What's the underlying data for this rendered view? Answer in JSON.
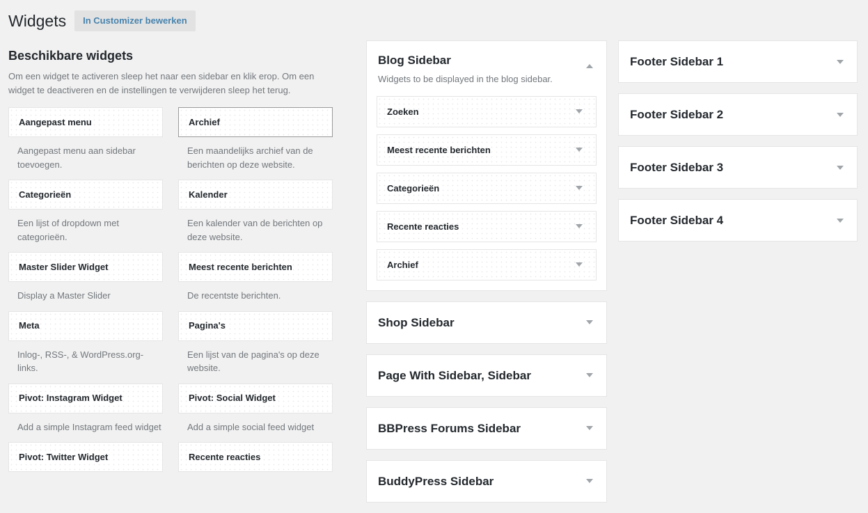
{
  "header": {
    "title": "Widgets",
    "customizer_link": "In Customizer bewerken"
  },
  "available": {
    "heading": "Beschikbare widgets",
    "description": "Om een widget te activeren sleep het naar een sidebar en klik erop. Om een widget te deactiveren en de instellingen te verwijderen sleep het terug.",
    "widgets": [
      {
        "title": "Aangepast menu",
        "description": "Aangepast menu aan sidebar toevoegen.",
        "active": false
      },
      {
        "title": "Archief",
        "description": "Een maandelijks archief van de berichten op deze website.",
        "active": true
      },
      {
        "title": "Categorieën",
        "description": "Een lijst of dropdown met categorieën.",
        "active": false
      },
      {
        "title": "Kalender",
        "description": "Een kalender van de berichten op deze website.",
        "active": false
      },
      {
        "title": "Master Slider Widget",
        "description": "Display a Master Slider",
        "active": false
      },
      {
        "title": "Meest recente berichten",
        "description": "De recentste berichten.",
        "active": false
      },
      {
        "title": "Meta",
        "description": "Inlog-, RSS-, & WordPress.org-links.",
        "active": false
      },
      {
        "title": "Pagina's",
        "description": "Een lijst van de pagina's op deze website.",
        "active": false
      },
      {
        "title": "Pivot: Instagram Widget",
        "description": "Add a simple Instagram feed widget",
        "active": false
      },
      {
        "title": "Pivot: Social Widget",
        "description": "Add a simple social feed widget",
        "active": false
      },
      {
        "title": "Pivot: Twitter Widget",
        "description": "",
        "active": false
      },
      {
        "title": "Recente reacties",
        "description": "",
        "active": false
      }
    ]
  },
  "center_sidebars": [
    {
      "name": "Blog Sidebar",
      "description": "Widgets to be displayed in the blog sidebar.",
      "expanded": true,
      "toggle_icon": "chevron-up-icon",
      "widgets": [
        {
          "title": "Zoeken",
          "toggle_icon": "chevron-down-icon"
        },
        {
          "title": "Meest recente berichten",
          "toggle_icon": "chevron-down-icon"
        },
        {
          "title": "Categorieën",
          "toggle_icon": "chevron-down-icon"
        },
        {
          "title": "Recente reacties",
          "toggle_icon": "chevron-down-icon"
        },
        {
          "title": "Archief",
          "toggle_icon": "chevron-down-icon"
        }
      ]
    },
    {
      "name": "Shop Sidebar",
      "description": "",
      "expanded": false,
      "toggle_icon": "chevron-down-icon",
      "widgets": []
    },
    {
      "name": "Page With Sidebar, Sidebar",
      "description": "",
      "expanded": false,
      "toggle_icon": "chevron-down-icon",
      "widgets": []
    },
    {
      "name": "BBPress Forums Sidebar",
      "description": "",
      "expanded": false,
      "toggle_icon": "chevron-down-icon",
      "widgets": []
    },
    {
      "name": "BuddyPress Sidebar",
      "description": "",
      "expanded": false,
      "toggle_icon": "chevron-down-icon",
      "widgets": []
    }
  ],
  "right_sidebars": [
    {
      "name": "Footer Sidebar 1",
      "expanded": false,
      "toggle_icon": "chevron-down-icon"
    },
    {
      "name": "Footer Sidebar 2",
      "expanded": false,
      "toggle_icon": "chevron-down-icon"
    },
    {
      "name": "Footer Sidebar 3",
      "expanded": false,
      "toggle_icon": "chevron-down-icon"
    },
    {
      "name": "Footer Sidebar 4",
      "expanded": false,
      "toggle_icon": "chevron-down-icon"
    }
  ],
  "colors": {
    "page_background": "#f1f1f1",
    "panel_background": "#ffffff",
    "border": "#e5e5e5",
    "active_border": "#999999",
    "heading_text": "#23282d",
    "muted_text": "#72777c",
    "link_blue": "#4783ad",
    "arrow_gray": "#a0a5aa"
  }
}
